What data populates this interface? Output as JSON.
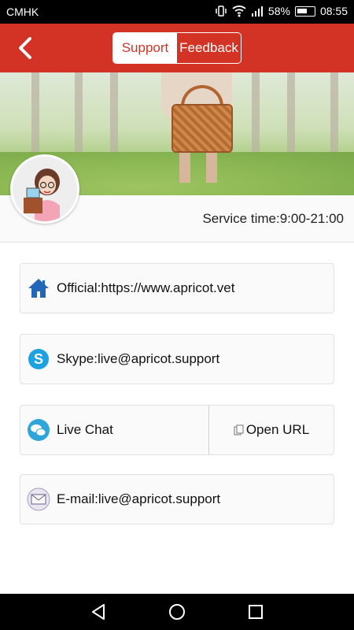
{
  "status_bar": {
    "carrier": "CMHK",
    "battery_percent": "58%",
    "time": "08:55"
  },
  "header": {
    "tabs": [
      {
        "label": "Support",
        "active": true
      },
      {
        "label": "Feedback",
        "active": false
      }
    ],
    "color": "#d33325"
  },
  "service": {
    "time_text": "Service time:9:00-21:00"
  },
  "contacts": {
    "official": {
      "label": "Official:https://www.apricot.vet",
      "icon": "home-icon"
    },
    "skype": {
      "label": "Skype:live@apricot.support",
      "icon": "skype-icon"
    },
    "live_chat": {
      "label": "Live Chat",
      "icon": "chat-icon"
    },
    "open_url": {
      "label": "Open URL",
      "icon": "copy-icon"
    },
    "email": {
      "label": "E-mail:live@apricot.support",
      "icon": "envelope-icon"
    }
  },
  "nav": {
    "back": "triangle-back-icon",
    "home": "circle-home-icon",
    "recents": "square-recents-icon"
  }
}
